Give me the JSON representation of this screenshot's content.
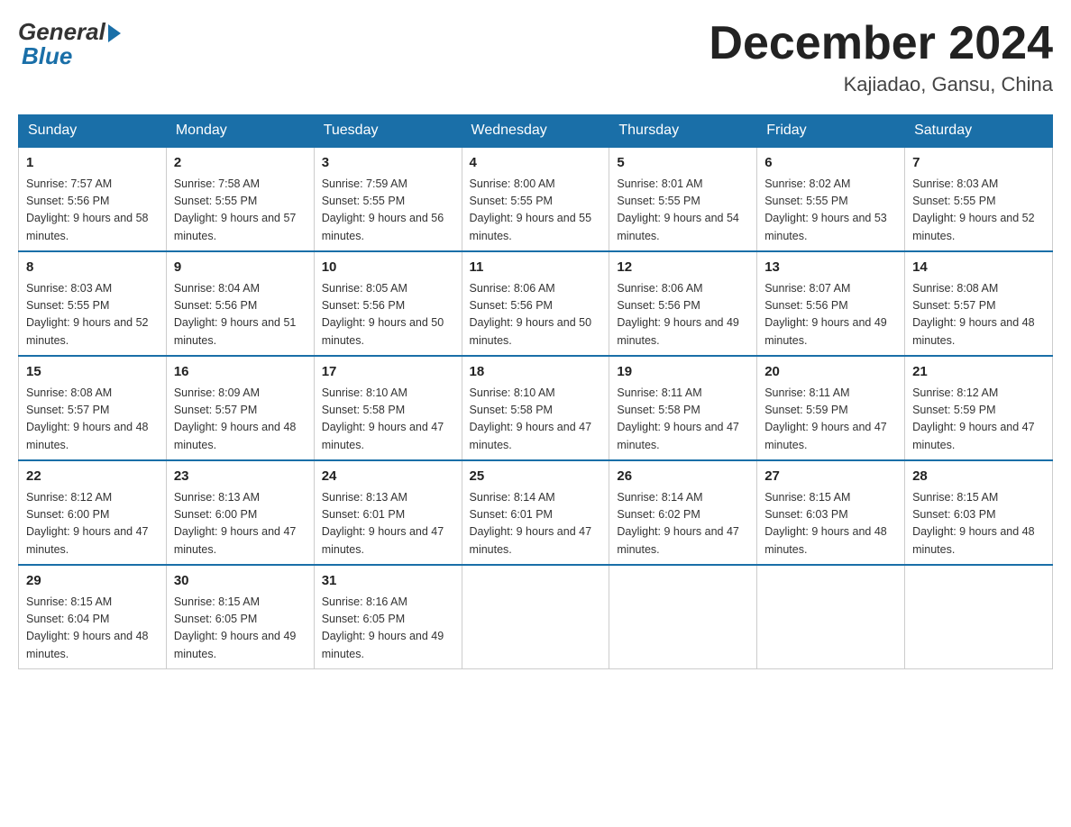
{
  "header": {
    "logo_general": "General",
    "logo_blue": "Blue",
    "month_title": "December 2024",
    "subtitle": "Kajiadao, Gansu, China"
  },
  "days_of_week": [
    "Sunday",
    "Monday",
    "Tuesday",
    "Wednesday",
    "Thursday",
    "Friday",
    "Saturday"
  ],
  "weeks": [
    [
      {
        "day": "1",
        "sunrise": "7:57 AM",
        "sunset": "5:56 PM",
        "daylight": "9 hours and 58 minutes."
      },
      {
        "day": "2",
        "sunrise": "7:58 AM",
        "sunset": "5:55 PM",
        "daylight": "9 hours and 57 minutes."
      },
      {
        "day": "3",
        "sunrise": "7:59 AM",
        "sunset": "5:55 PM",
        "daylight": "9 hours and 56 minutes."
      },
      {
        "day": "4",
        "sunrise": "8:00 AM",
        "sunset": "5:55 PM",
        "daylight": "9 hours and 55 minutes."
      },
      {
        "day": "5",
        "sunrise": "8:01 AM",
        "sunset": "5:55 PM",
        "daylight": "9 hours and 54 minutes."
      },
      {
        "day": "6",
        "sunrise": "8:02 AM",
        "sunset": "5:55 PM",
        "daylight": "9 hours and 53 minutes."
      },
      {
        "day": "7",
        "sunrise": "8:03 AM",
        "sunset": "5:55 PM",
        "daylight": "9 hours and 52 minutes."
      }
    ],
    [
      {
        "day": "8",
        "sunrise": "8:03 AM",
        "sunset": "5:55 PM",
        "daylight": "9 hours and 52 minutes."
      },
      {
        "day": "9",
        "sunrise": "8:04 AM",
        "sunset": "5:56 PM",
        "daylight": "9 hours and 51 minutes."
      },
      {
        "day": "10",
        "sunrise": "8:05 AM",
        "sunset": "5:56 PM",
        "daylight": "9 hours and 50 minutes."
      },
      {
        "day": "11",
        "sunrise": "8:06 AM",
        "sunset": "5:56 PM",
        "daylight": "9 hours and 50 minutes."
      },
      {
        "day": "12",
        "sunrise": "8:06 AM",
        "sunset": "5:56 PM",
        "daylight": "9 hours and 49 minutes."
      },
      {
        "day": "13",
        "sunrise": "8:07 AM",
        "sunset": "5:56 PM",
        "daylight": "9 hours and 49 minutes."
      },
      {
        "day": "14",
        "sunrise": "8:08 AM",
        "sunset": "5:57 PM",
        "daylight": "9 hours and 48 minutes."
      }
    ],
    [
      {
        "day": "15",
        "sunrise": "8:08 AM",
        "sunset": "5:57 PM",
        "daylight": "9 hours and 48 minutes."
      },
      {
        "day": "16",
        "sunrise": "8:09 AM",
        "sunset": "5:57 PM",
        "daylight": "9 hours and 48 minutes."
      },
      {
        "day": "17",
        "sunrise": "8:10 AM",
        "sunset": "5:58 PM",
        "daylight": "9 hours and 47 minutes."
      },
      {
        "day": "18",
        "sunrise": "8:10 AM",
        "sunset": "5:58 PM",
        "daylight": "9 hours and 47 minutes."
      },
      {
        "day": "19",
        "sunrise": "8:11 AM",
        "sunset": "5:58 PM",
        "daylight": "9 hours and 47 minutes."
      },
      {
        "day": "20",
        "sunrise": "8:11 AM",
        "sunset": "5:59 PM",
        "daylight": "9 hours and 47 minutes."
      },
      {
        "day": "21",
        "sunrise": "8:12 AM",
        "sunset": "5:59 PM",
        "daylight": "9 hours and 47 minutes."
      }
    ],
    [
      {
        "day": "22",
        "sunrise": "8:12 AM",
        "sunset": "6:00 PM",
        "daylight": "9 hours and 47 minutes."
      },
      {
        "day": "23",
        "sunrise": "8:13 AM",
        "sunset": "6:00 PM",
        "daylight": "9 hours and 47 minutes."
      },
      {
        "day": "24",
        "sunrise": "8:13 AM",
        "sunset": "6:01 PM",
        "daylight": "9 hours and 47 minutes."
      },
      {
        "day": "25",
        "sunrise": "8:14 AM",
        "sunset": "6:01 PM",
        "daylight": "9 hours and 47 minutes."
      },
      {
        "day": "26",
        "sunrise": "8:14 AM",
        "sunset": "6:02 PM",
        "daylight": "9 hours and 47 minutes."
      },
      {
        "day": "27",
        "sunrise": "8:15 AM",
        "sunset": "6:03 PM",
        "daylight": "9 hours and 48 minutes."
      },
      {
        "day": "28",
        "sunrise": "8:15 AM",
        "sunset": "6:03 PM",
        "daylight": "9 hours and 48 minutes."
      }
    ],
    [
      {
        "day": "29",
        "sunrise": "8:15 AM",
        "sunset": "6:04 PM",
        "daylight": "9 hours and 48 minutes."
      },
      {
        "day": "30",
        "sunrise": "8:15 AM",
        "sunset": "6:05 PM",
        "daylight": "9 hours and 49 minutes."
      },
      {
        "day": "31",
        "sunrise": "8:16 AM",
        "sunset": "6:05 PM",
        "daylight": "9 hours and 49 minutes."
      },
      null,
      null,
      null,
      null
    ]
  ]
}
